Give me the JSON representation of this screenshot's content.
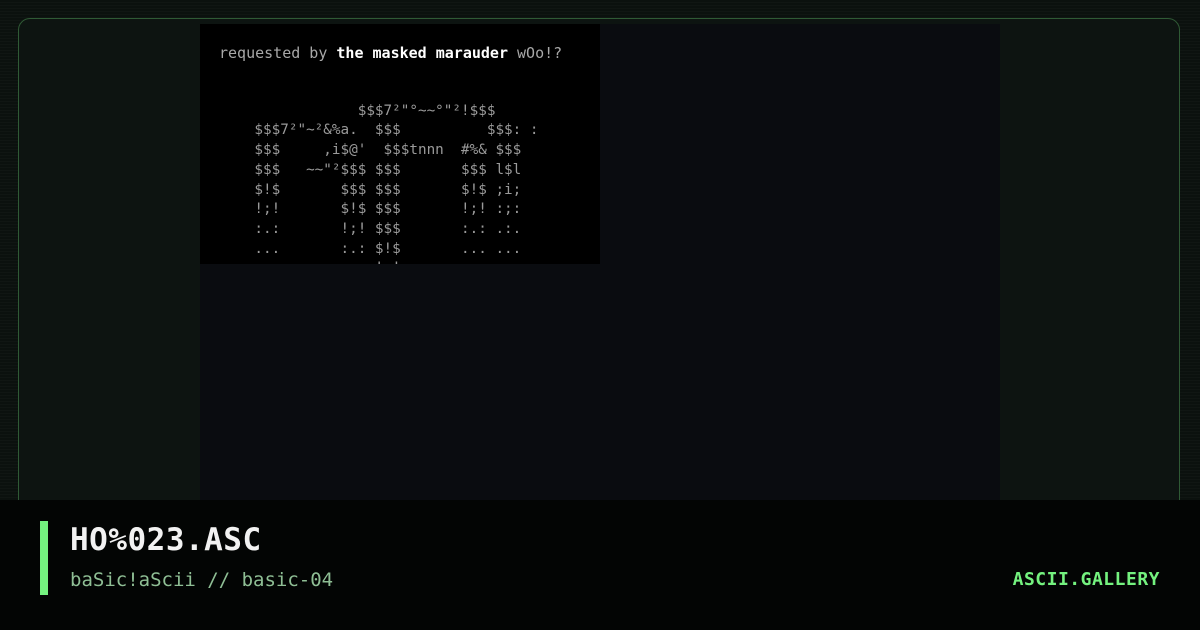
{
  "art": {
    "header_prefix": "requested by ",
    "header_highlight": "the masked marauder",
    "header_suffix": " wOo!?",
    "lines": [
      "",
      "                $$$7²\"°~~°\"²!$$$",
      "    $$$7²\"~²&%a.  $$$          $$$: :",
      "    $$$     ,i$@'  $$$tnnn  #%& $$$",
      "    $$$   ~~\"²$$$ $$$       $$$ l$l",
      "    $!$       $$$ $$$       $!$ ;i;",
      "    !;!       $!$ $$$       !;! :;:",
      "    :.:       !;! $$$       :.: .:.",
      "    ...       :.: $!$       ... ...",
      "    ...       ... !;!       ... ..."
    ]
  },
  "caption": {
    "title": "HO%023.ASC",
    "subtitle": "baSic!aScii // basic-04",
    "brand": "ASCII.GALLERY"
  },
  "colors": {
    "accent": "#74f27f",
    "frame_border": "#2f5a35",
    "art_text": "#9a9a9a"
  }
}
